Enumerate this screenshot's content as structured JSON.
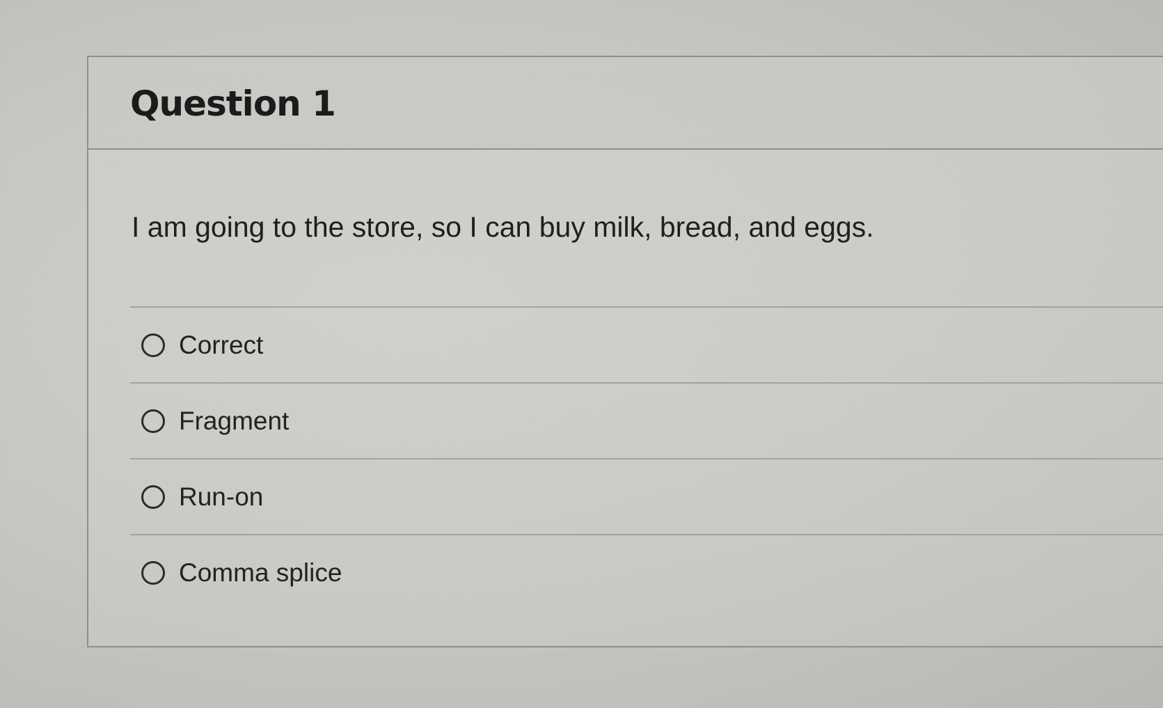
{
  "question": {
    "title": "Question 1",
    "prompt": "I am going to the store, so I can buy milk, bread, and eggs.",
    "options": [
      {
        "label": "Correct",
        "selected": false
      },
      {
        "label": "Fragment",
        "selected": false
      },
      {
        "label": "Run-on",
        "selected": false
      },
      {
        "label": "Comma splice",
        "selected": false
      }
    ]
  },
  "colors": {
    "background": "#c6c7c2",
    "border": "#8e8f8a",
    "text": "#1e1e1e"
  }
}
